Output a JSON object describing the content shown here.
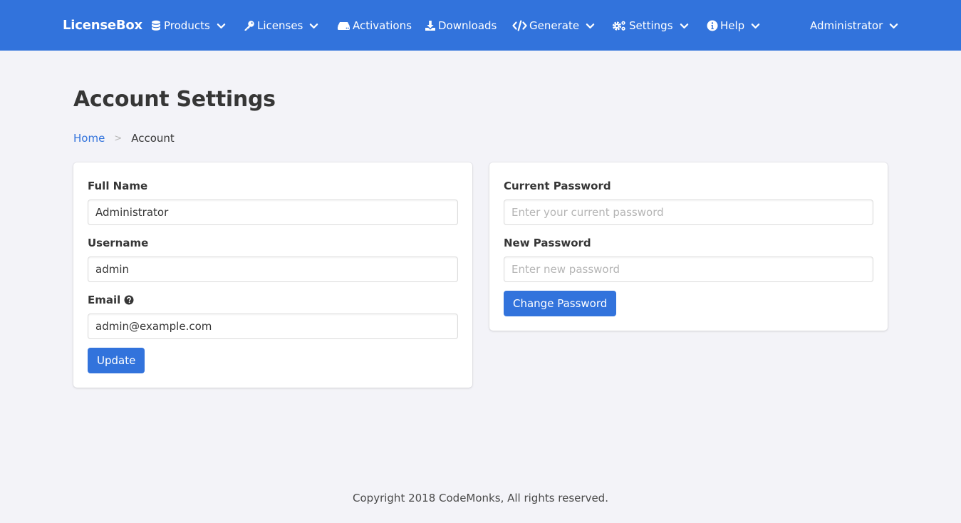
{
  "colors": {
    "primary": "#3273dc",
    "background": "#f3f3f8"
  },
  "navbar": {
    "brand": "LicenseBox",
    "items": [
      {
        "label": "Products",
        "icon": "database-icon",
        "dropdown": true
      },
      {
        "label": "Licenses",
        "icon": "key-icon",
        "dropdown": true
      },
      {
        "label": "Activations",
        "icon": "hdd-icon",
        "dropdown": false
      },
      {
        "label": "Downloads",
        "icon": "download-icon",
        "dropdown": false
      },
      {
        "label": "Generate",
        "icon": "code-icon",
        "dropdown": true
      },
      {
        "label": "Settings",
        "icon": "cogs-icon",
        "dropdown": true
      },
      {
        "label": "Help",
        "icon": "info-circle-icon",
        "dropdown": true
      }
    ],
    "user": "Administrator"
  },
  "page": {
    "title": "Account Settings",
    "breadcrumb": {
      "home": "Home",
      "separator": ">",
      "current": "Account"
    }
  },
  "account_form": {
    "full_name_label": "Full Name",
    "full_name_value": "Administrator",
    "username_label": "Username",
    "username_value": "admin",
    "email_label": "Email",
    "email_value": "admin@example.com",
    "submit_label": "Update"
  },
  "password_form": {
    "current_label": "Current Password",
    "current_placeholder": "Enter your current password",
    "new_label": "New Password",
    "new_placeholder": "Enter new password",
    "submit_label": "Change Password"
  },
  "footer": {
    "text": "Copyright 2018 CodeMonks, All rights reserved."
  }
}
